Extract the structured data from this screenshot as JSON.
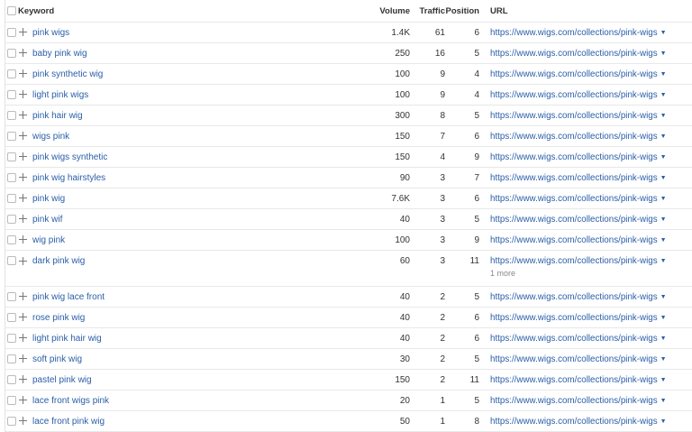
{
  "header": {
    "keyword": "Keyword",
    "volume": "Volume",
    "traffic": "Traffic",
    "position": "Position",
    "url": "URL"
  },
  "rows": [
    {
      "keyword": "pink wigs",
      "volume": "1.4K",
      "traffic": "61",
      "position": "6",
      "url": "https://www.wigs.com/collections/pink-wigs"
    },
    {
      "keyword": "baby pink wig",
      "volume": "250",
      "traffic": "16",
      "position": "5",
      "url": "https://www.wigs.com/collections/pink-wigs"
    },
    {
      "keyword": "pink synthetic wig",
      "volume": "100",
      "traffic": "9",
      "position": "4",
      "url": "https://www.wigs.com/collections/pink-wigs"
    },
    {
      "keyword": "light pink wigs",
      "volume": "100",
      "traffic": "9",
      "position": "4",
      "url": "https://www.wigs.com/collections/pink-wigs"
    },
    {
      "keyword": "pink hair wig",
      "volume": "300",
      "traffic": "8",
      "position": "5",
      "url": "https://www.wigs.com/collections/pink-wigs"
    },
    {
      "keyword": "wigs pink",
      "volume": "150",
      "traffic": "7",
      "position": "6",
      "url": "https://www.wigs.com/collections/pink-wigs"
    },
    {
      "keyword": "pink wigs synthetic",
      "volume": "150",
      "traffic": "4",
      "position": "9",
      "url": "https://www.wigs.com/collections/pink-wigs"
    },
    {
      "keyword": "pink wig hairstyles",
      "volume": "90",
      "traffic": "3",
      "position": "7",
      "url": "https://www.wigs.com/collections/pink-wigs"
    },
    {
      "keyword": "pink wig",
      "volume": "7.6K",
      "traffic": "3",
      "position": "6",
      "url": "https://www.wigs.com/collections/pink-wigs"
    },
    {
      "keyword": "pink wif",
      "volume": "40",
      "traffic": "3",
      "position": "5",
      "url": "https://www.wigs.com/collections/pink-wigs"
    },
    {
      "keyword": "wig pink",
      "volume": "100",
      "traffic": "3",
      "position": "9",
      "url": "https://www.wigs.com/collections/pink-wigs"
    },
    {
      "keyword": "dark pink wig",
      "volume": "60",
      "traffic": "3",
      "position": "11",
      "url": "https://www.wigs.com/collections/pink-wigs",
      "more": "1 more"
    },
    {
      "keyword": "pink wig lace front",
      "volume": "40",
      "traffic": "2",
      "position": "5",
      "url": "https://www.wigs.com/collections/pink-wigs"
    },
    {
      "keyword": "rose pink wig",
      "volume": "40",
      "traffic": "2",
      "position": "6",
      "url": "https://www.wigs.com/collections/pink-wigs"
    },
    {
      "keyword": "light pink hair wig",
      "volume": "40",
      "traffic": "2",
      "position": "6",
      "url": "https://www.wigs.com/collections/pink-wigs"
    },
    {
      "keyword": "soft pink wig",
      "volume": "30",
      "traffic": "2",
      "position": "5",
      "url": "https://www.wigs.com/collections/pink-wigs"
    },
    {
      "keyword": "pastel pink wig",
      "volume": "150",
      "traffic": "2",
      "position": "11",
      "url": "https://www.wigs.com/collections/pink-wigs"
    },
    {
      "keyword": "lace front wigs pink",
      "volume": "20",
      "traffic": "1",
      "position": "5",
      "url": "https://www.wigs.com/collections/pink-wigs"
    },
    {
      "keyword": "lace front pink wig",
      "volume": "50",
      "traffic": "1",
      "position": "8",
      "url": "https://www.wigs.com/collections/pink-wigs"
    }
  ],
  "icons": {
    "row_add": "plus-icon",
    "url_menu": "caret-down-icon",
    "select": "checkbox"
  },
  "colors": {
    "link": "#2a5ea8",
    "text": "#333333",
    "divider": "#e8e8e8"
  }
}
